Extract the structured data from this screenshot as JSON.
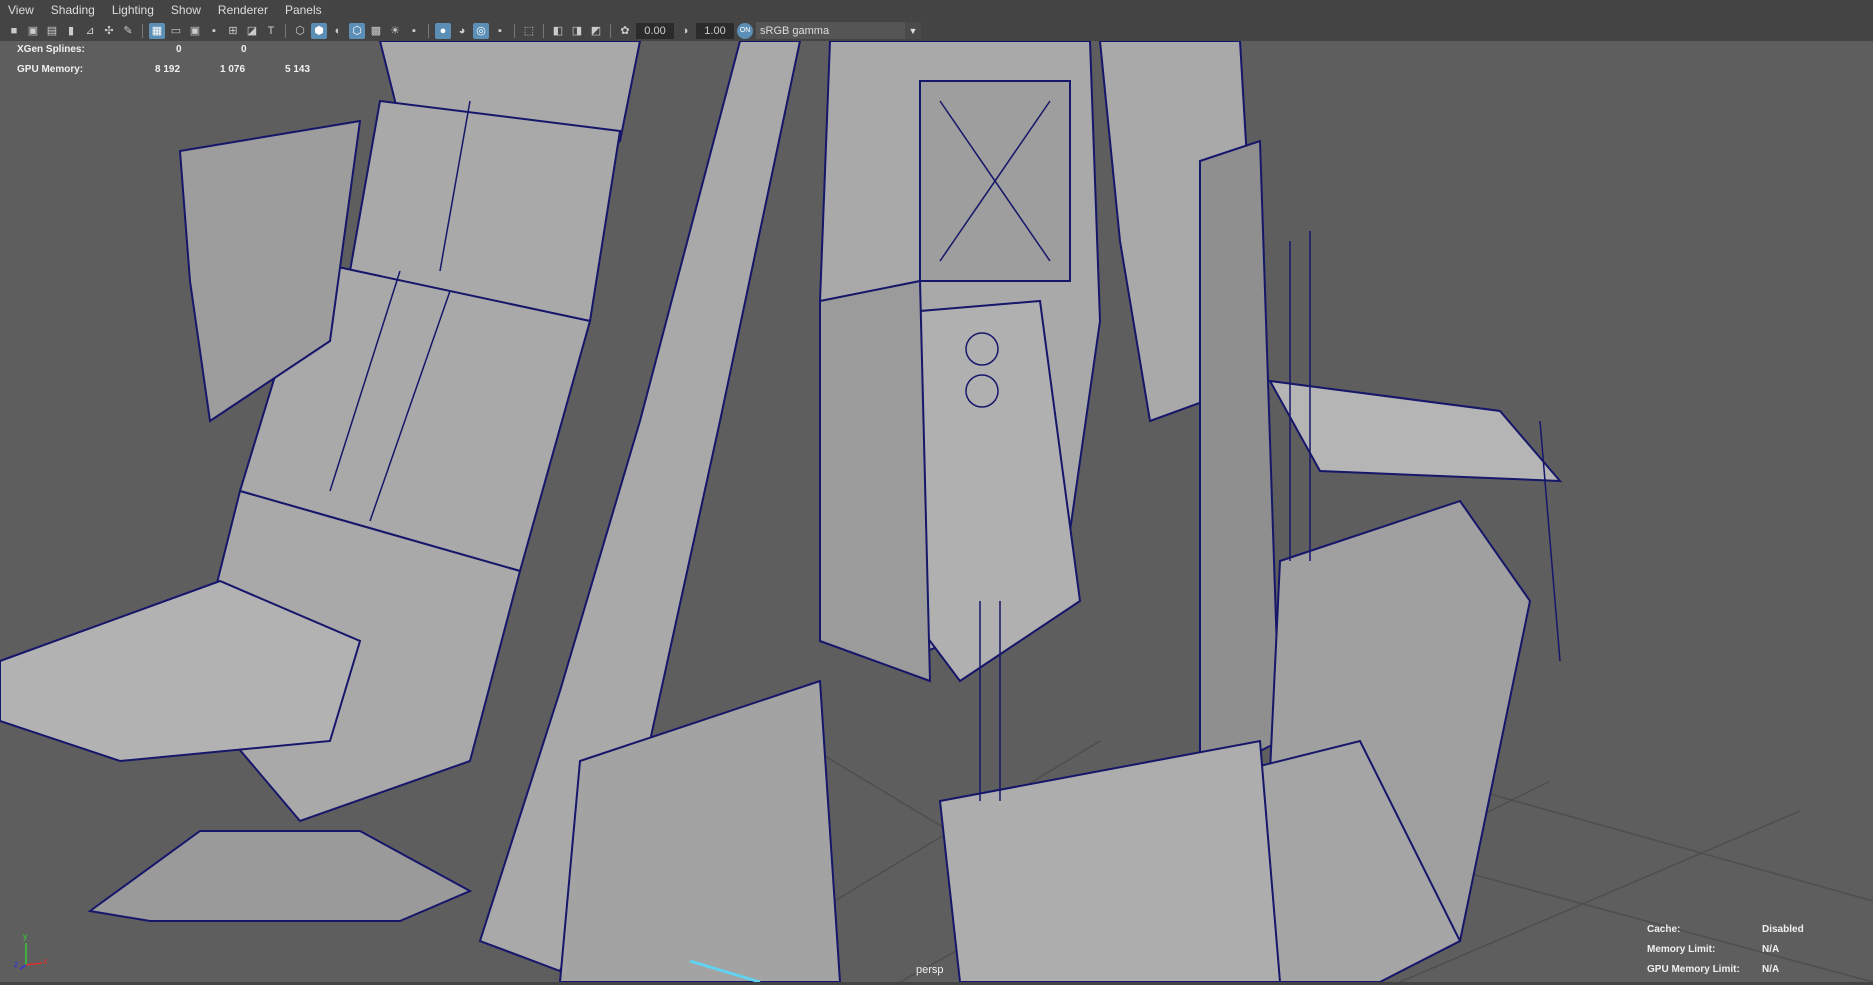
{
  "menu": [
    "View",
    "Shading",
    "Lighting",
    "Show",
    "Renderer",
    "Panels"
  ],
  "toolbar": {
    "icons": [
      "camera-icon",
      "lock-camera-icon",
      "bookmark-camera-icon",
      "bookmark-icon",
      "image-plane-icon",
      "pivot-icon",
      "pen-icon",
      "grid-icon",
      "film-gate-icon",
      "resolution-gate-icon",
      "gate-mask-icon",
      "field-chart-icon",
      "safe-action-icon",
      "safe-title-icon",
      "wireframe-icon",
      "smooth-shade-icon",
      "default-material-icon",
      "wireframe-on-shaded-icon",
      "textured-icon",
      "lights-icon",
      "shadows-icon",
      "ssao-icon",
      "motion-blur-icon",
      "anti-alias-icon",
      "depth-of-field-icon",
      "isolate-select-icon",
      "xray-icon",
      "xray-joints-icon",
      "xray-components-icon",
      "exposure-icon",
      "gamma-icon",
      "color-management-icon"
    ],
    "exposure": "0.00",
    "gamma": "1.00",
    "color_space": "sRGB gamma"
  },
  "hud_top": {
    "rows": [
      {
        "label": "XGen Splines:",
        "values": [
          "0",
          "0",
          ""
        ]
      },
      {
        "label": "GPU Memory:",
        "values": [
          "8 192",
          "1 076",
          "5 143"
        ]
      }
    ]
  },
  "hud_bottom": {
    "rows": [
      {
        "label": "Cache:",
        "value": "Disabled"
      },
      {
        "label": "Memory Limit:",
        "value": "N/A"
      },
      {
        "label": "GPU Memory Limit:",
        "value": "N/A"
      }
    ]
  },
  "camera_label": "persp",
  "axis": {
    "x": "x",
    "y": "y",
    "z": "z"
  }
}
